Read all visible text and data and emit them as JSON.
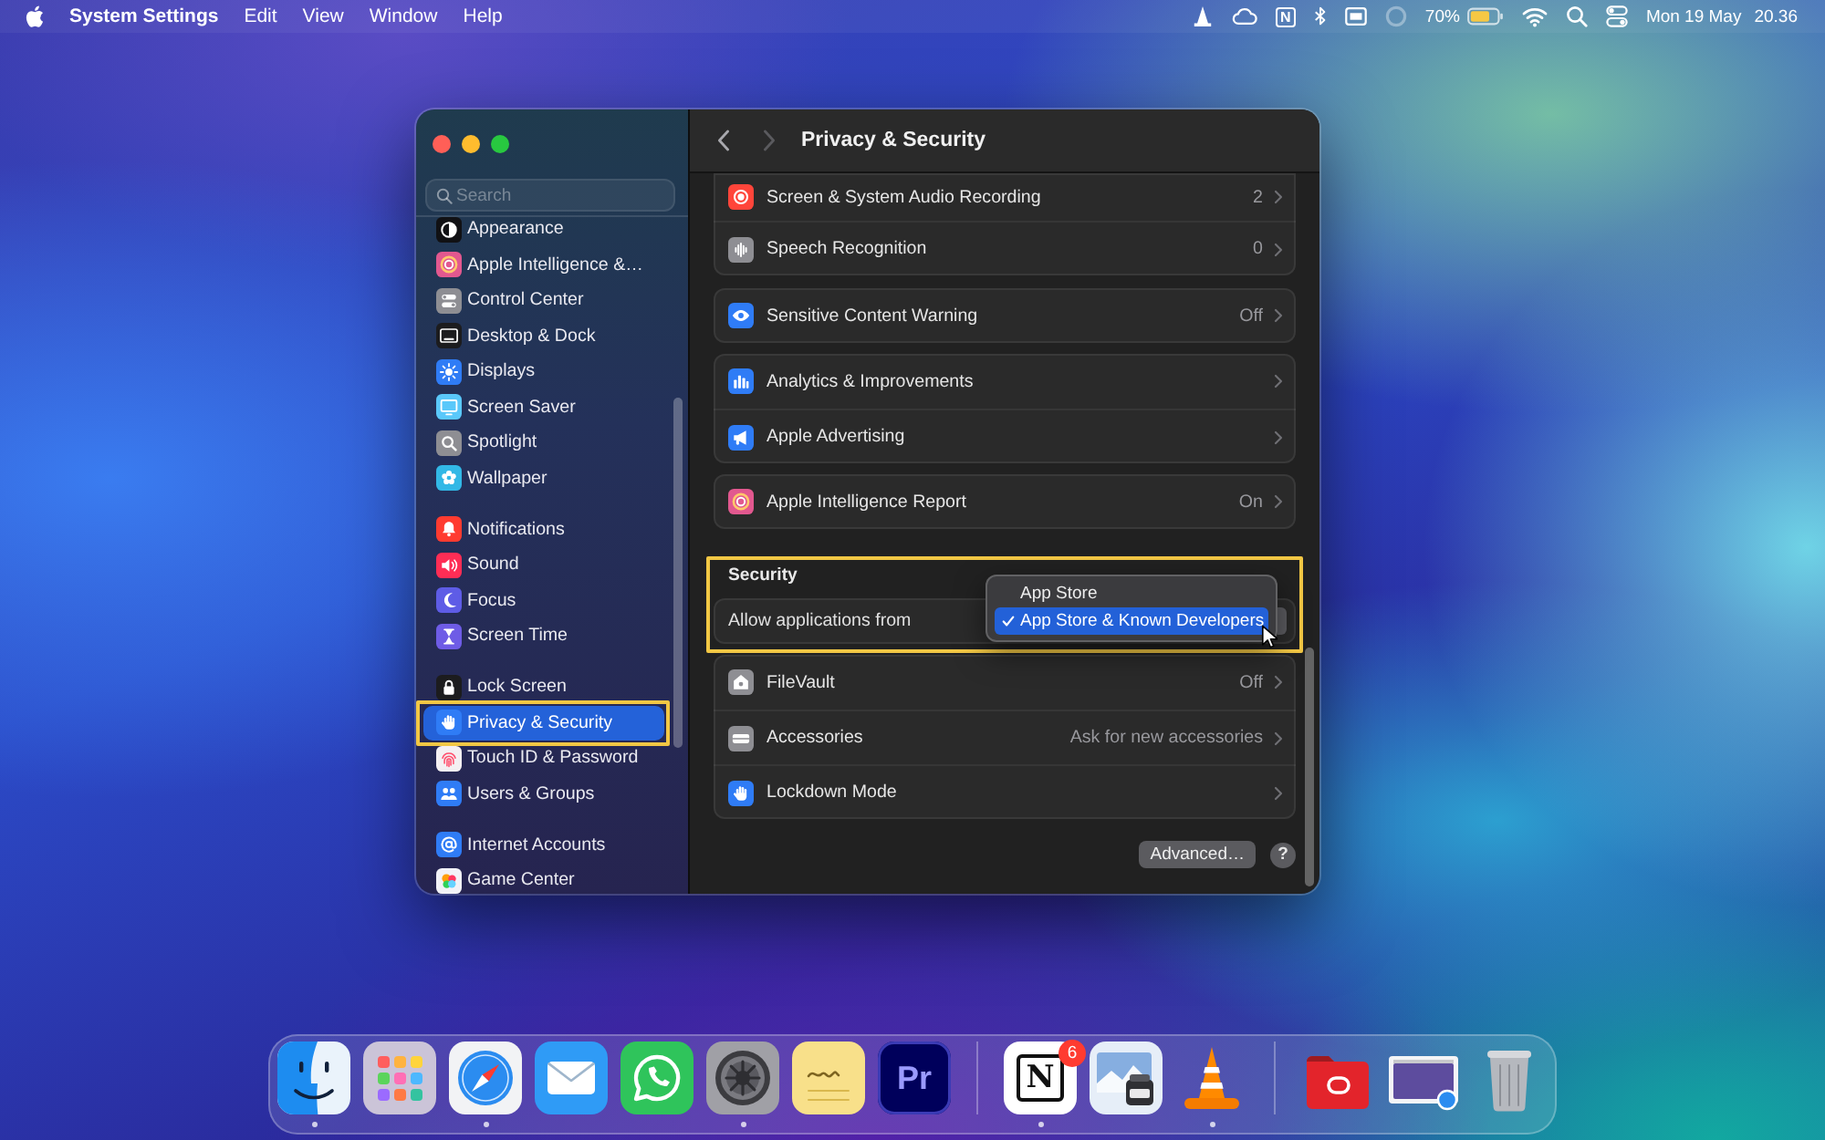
{
  "menu_bar": {
    "app_name": "System Settings",
    "menus": [
      "Edit",
      "View",
      "Window",
      "Help"
    ],
    "status_letter": "N",
    "battery": "70%",
    "date": "Mon 19 May",
    "time": "20.36"
  },
  "window": {
    "title": "Privacy & Security",
    "back_enabled": true,
    "forward_enabled": false
  },
  "sidebar": {
    "search": {
      "placeholder": "Search"
    },
    "highlight_selected": true,
    "sections": [
      {
        "items": [
          {
            "label": "Appearance",
            "selected": false
          },
          {
            "label": "Apple Intelligence &…",
            "selected": false
          },
          {
            "label": "Control Center",
            "selected": false
          },
          {
            "label": "Desktop & Dock",
            "selected": false
          },
          {
            "label": "Displays",
            "selected": false
          },
          {
            "label": "Screen Saver",
            "selected": false
          },
          {
            "label": "Spotlight",
            "selected": false
          },
          {
            "label": "Wallpaper",
            "selected": false
          }
        ]
      },
      {
        "items": [
          {
            "label": "Notifications",
            "selected": false
          },
          {
            "label": "Sound",
            "selected": false
          },
          {
            "label": "Focus",
            "selected": false
          },
          {
            "label": "Screen Time",
            "selected": false
          }
        ]
      },
      {
        "items": [
          {
            "label": "Lock Screen",
            "selected": false
          },
          {
            "label": "Privacy & Security",
            "selected": true
          },
          {
            "label": "Touch ID & Password",
            "selected": false
          },
          {
            "label": "Users & Groups",
            "selected": false
          }
        ]
      },
      {
        "items": [
          {
            "label": "Internet Accounts",
            "selected": false
          },
          {
            "label": "Game Center",
            "selected": false
          }
        ]
      }
    ]
  },
  "content": {
    "groups": [
      {
        "rows": [
          {
            "label": "Screen & System Audio Recording",
            "value": "2"
          },
          {
            "label": "Speech Recognition",
            "value": "0"
          }
        ]
      },
      {
        "rows": [
          {
            "label": "Sensitive Content Warning",
            "value": "Off"
          }
        ]
      },
      {
        "rows": [
          {
            "label": "Analytics & Improvements"
          },
          {
            "label": "Apple Advertising"
          }
        ]
      },
      {
        "rows": [
          {
            "label": "Apple Intelligence Report",
            "value": "On"
          }
        ]
      }
    ],
    "security": {
      "title": "Security",
      "highlighted": true,
      "allow": {
        "label": "Allow applications from",
        "menu": [
          {
            "label": "App Store",
            "selected": false
          },
          {
            "label": "App Store & Known Developers",
            "selected": true
          }
        ]
      },
      "rows": [
        {
          "label": "FileVault",
          "value": "Off"
        },
        {
          "label": "Accessories",
          "value": "Ask for new accessories"
        },
        {
          "label": "Lockdown Mode"
        }
      ]
    },
    "advanced_button": "Advanced…",
    "help_button": "?"
  },
  "dock": {
    "apps": [
      {
        "running": true
      },
      {
        "running": false
      },
      {
        "running": true
      },
      {
        "running": false
      },
      {
        "running": false
      },
      {
        "running": true
      },
      {
        "running": false
      },
      {
        "running": false,
        "letters": "Pr"
      },
      {
        "running": true,
        "letters": "N",
        "badge": "6"
      },
      {
        "running": false
      },
      {
        "running": true
      },
      {
        "running": false
      },
      {
        "running": false
      },
      {
        "running": false
      }
    ]
  }
}
